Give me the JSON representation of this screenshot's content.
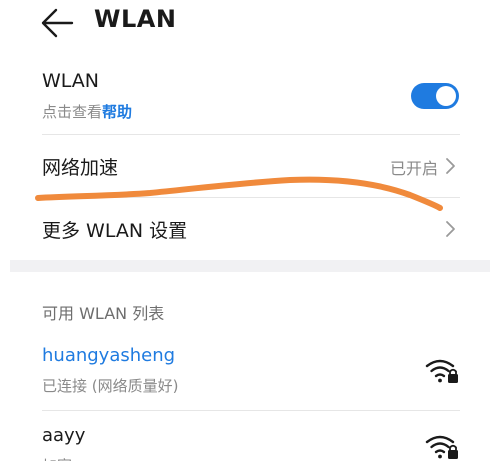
{
  "header": {
    "title": "WLAN"
  },
  "wlan_row": {
    "label": "WLAN",
    "sub_prefix": "点击查看",
    "sub_link": "帮助",
    "enabled": true
  },
  "speed_row": {
    "label": "网络加速",
    "value": "已开启"
  },
  "more_row": {
    "label": "更多 WLAN 设置"
  },
  "available": {
    "header": "可用 WLAN 列表",
    "networks": [
      {
        "ssid": "huangyasheng",
        "status": "已连接 (网络质量好)",
        "connected": true,
        "secured": true
      },
      {
        "ssid": "aayy",
        "status": "加密",
        "connected": false,
        "secured": true
      }
    ]
  },
  "colors": {
    "accent": "#1f7be0",
    "scribble": "#f08a3c"
  }
}
